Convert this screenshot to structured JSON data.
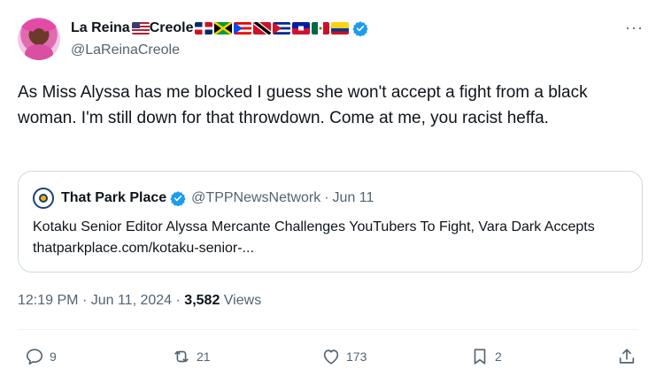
{
  "author": {
    "display_name": "La Reina",
    "display_name_suffix": "Creole",
    "handle": "@LaReinaCreole",
    "flags": [
      "us",
      "dominican-republic",
      "jamaica",
      "puerto-rico",
      "trinidad-tobago",
      "cuba",
      "haiti",
      "mexico",
      "colombia"
    ]
  },
  "tweet": {
    "text": "As Miss Alyssa has me blocked I guess she won't accept a fight from a black woman.  I'm still down for that throwdown.  Come at me, you racist heffa.",
    "time": "12:19 PM",
    "date": "Jun 11, 2024",
    "views_count": "3,582",
    "views_label": "Views"
  },
  "quote": {
    "name": "That Park Place",
    "handle": "@TPPNewsNetwork",
    "date": "Jun 11",
    "text": "Kotaku Senior Editor Alyssa Mercante Challenges YouTubers To Fight, Vara Dark Accepts  thatparkplace.com/kotaku-senior-..."
  },
  "actions": {
    "replies": "9",
    "reposts": "21",
    "likes": "173",
    "bookmarks": "2"
  },
  "colors": {
    "verified": "#1d9bf0",
    "muted": "#536471"
  }
}
